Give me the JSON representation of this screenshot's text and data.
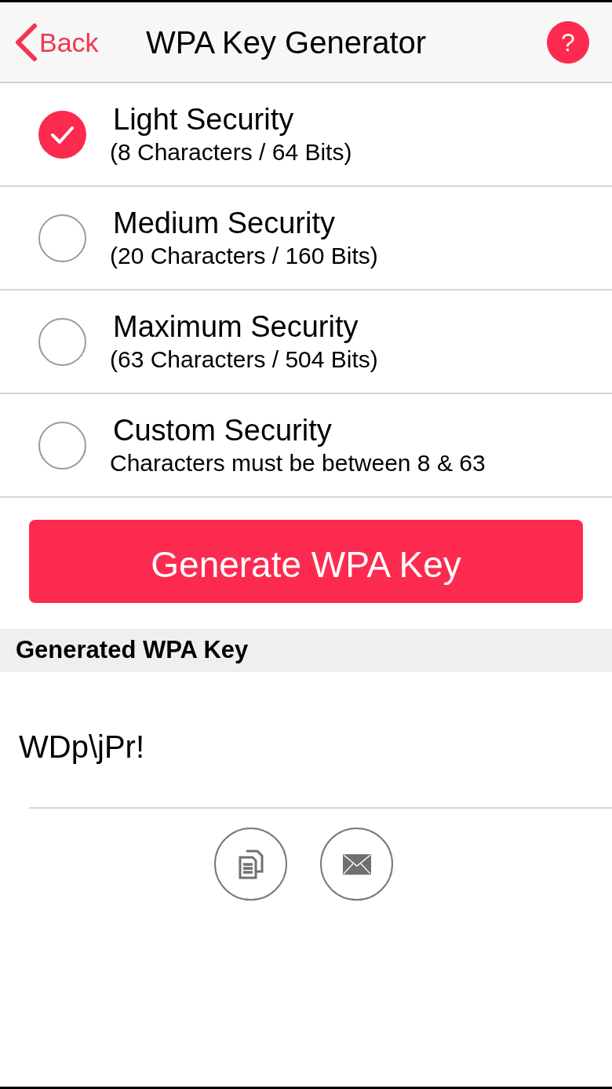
{
  "nav": {
    "back_label": "Back",
    "title": "WPA Key Generator",
    "help_label": "?"
  },
  "options": [
    {
      "title": "Light Security",
      "subtitle": "(8 Characters / 64 Bits)",
      "selected": true
    },
    {
      "title": "Medium Security",
      "subtitle": "(20 Characters / 160 Bits)",
      "selected": false
    },
    {
      "title": "Maximum Security",
      "subtitle": "(63 Characters / 504 Bits)",
      "selected": false
    },
    {
      "title": "Custom Security",
      "subtitle": "Characters must be between 8 & 63",
      "selected": false
    }
  ],
  "generate_button": {
    "label": "Generate WPA Key"
  },
  "result": {
    "header": "Generated WPA Key",
    "value": "WDp\\jPr!"
  },
  "actions": [
    {
      "kind": "copy"
    },
    {
      "kind": "email"
    }
  ]
}
